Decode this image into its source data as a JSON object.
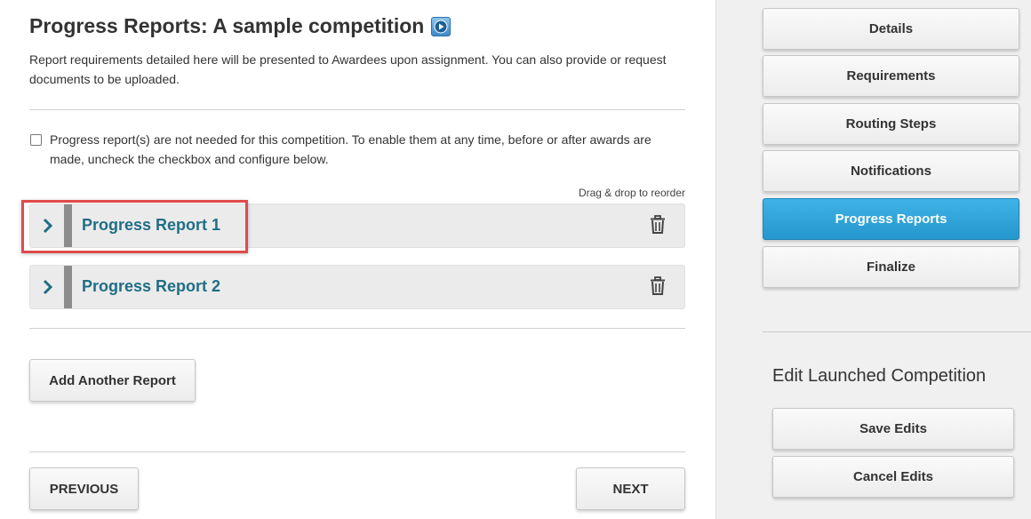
{
  "header": {
    "title": "Progress Reports: A sample competition",
    "video_icon": "play-video-icon",
    "intro": "Report requirements detailed here will be presented to Awardees upon assignment. You can also provide or request documents to be uploaded."
  },
  "option": {
    "checked": false,
    "label": "Progress report(s) are not needed for this competition. To enable them at any time, before or after awards are made, uncheck the checkbox and configure below."
  },
  "reports": {
    "drag_hint": "Drag & drop to reorder",
    "items": [
      {
        "title": "Progress Report 1",
        "highlighted": true
      },
      {
        "title": "Progress Report 2",
        "highlighted": false
      }
    ],
    "add_label": "Add Another Report"
  },
  "footer": {
    "previous_label": "PREVIOUS",
    "next_label": "NEXT"
  },
  "sidebar": {
    "items": [
      {
        "label": "Details",
        "active": false
      },
      {
        "label": "Requirements",
        "active": false
      },
      {
        "label": "Routing Steps",
        "active": false
      },
      {
        "label": "Notifications",
        "active": false
      },
      {
        "label": "Progress Reports",
        "active": true
      },
      {
        "label": "Finalize",
        "active": false
      }
    ],
    "edit_title": "Edit Launched Competition",
    "save_label": "Save Edits",
    "cancel_label": "Cancel Edits"
  },
  "colors": {
    "accent": "#2a9fd6",
    "link": "#1f6e86",
    "highlight": "#e04a4a"
  }
}
